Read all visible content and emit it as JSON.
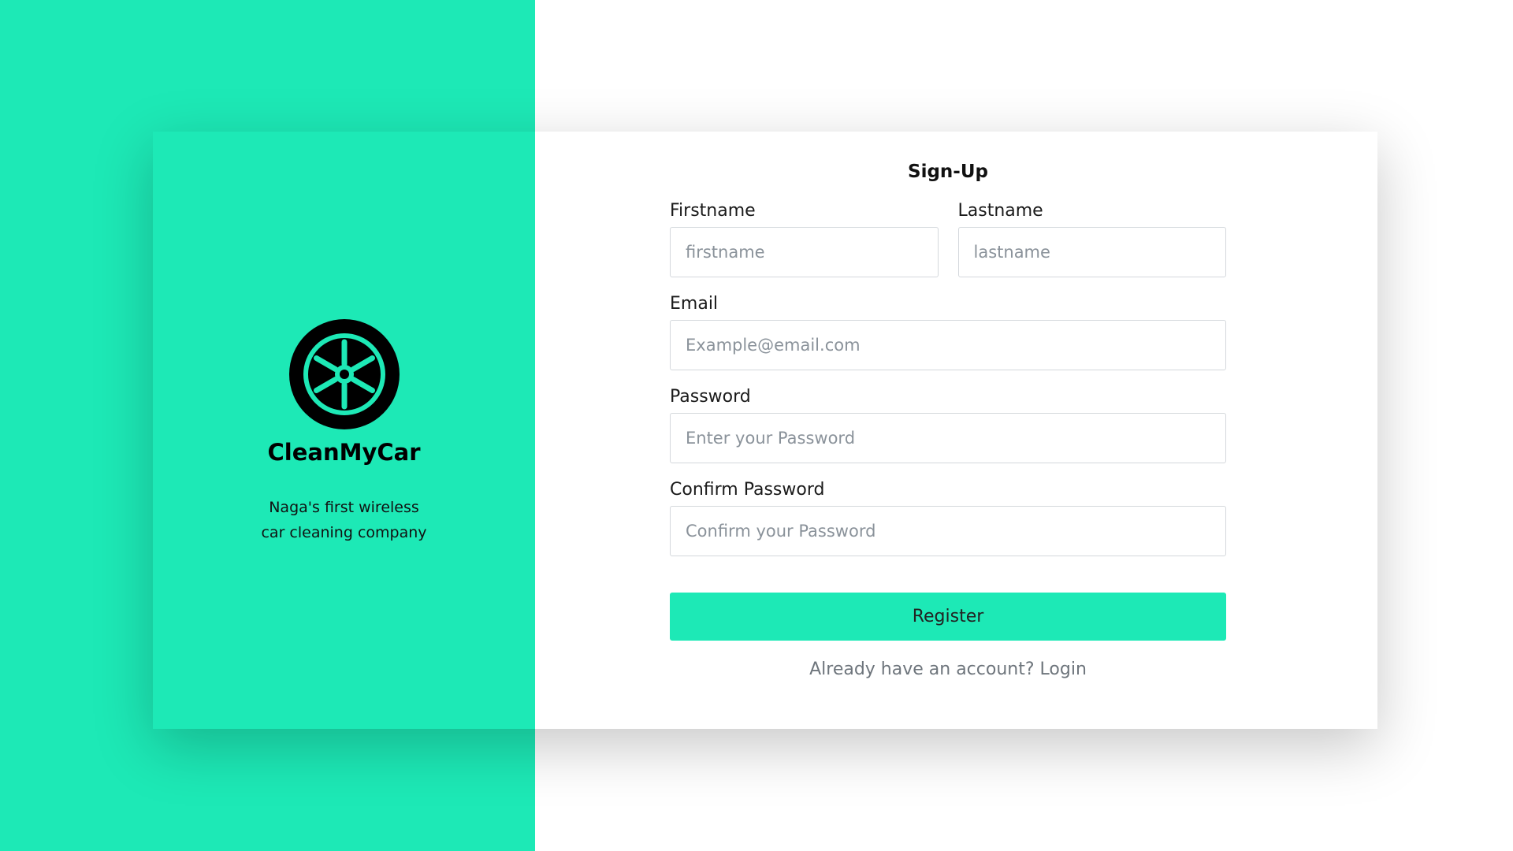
{
  "brand": {
    "name": "CleanMyCar",
    "tagline_line1": "Naga's first wireless",
    "tagline_line2": "car cleaning company",
    "logo_icon": "wheel-icon"
  },
  "form": {
    "title": "Sign-Up",
    "firstname": {
      "label": "Firstname",
      "placeholder": "firstname",
      "value": ""
    },
    "lastname": {
      "label": "Lastname",
      "placeholder": "lastname",
      "value": ""
    },
    "email": {
      "label": "Email",
      "placeholder": "Example@email.com",
      "value": ""
    },
    "password": {
      "label": "Password",
      "placeholder": "Enter your Password",
      "value": ""
    },
    "confirm_password": {
      "label": "Confirm Password",
      "placeholder": "Confirm your Password",
      "value": ""
    },
    "register_label": "Register",
    "login_prompt": "Already have an account?",
    "login_link": "Login"
  },
  "colors": {
    "accent": "#1de9b6",
    "background": "#ffffff",
    "text": "#111111",
    "muted_text": "#6e757c",
    "placeholder": "#8a929a"
  }
}
